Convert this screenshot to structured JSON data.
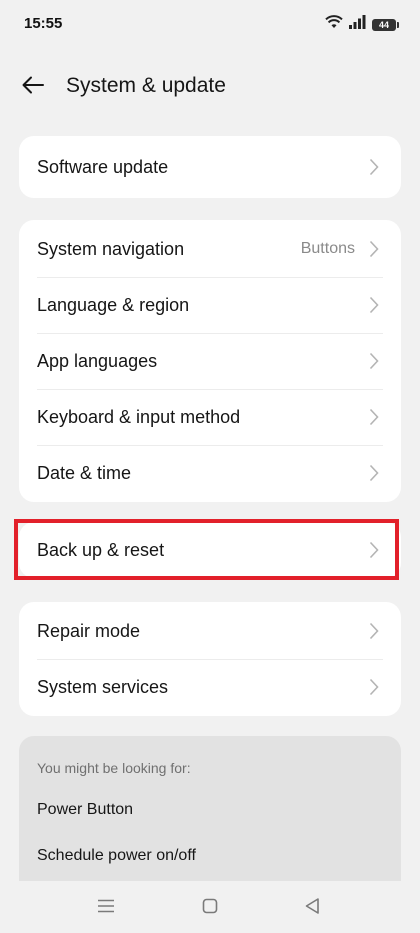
{
  "status_bar": {
    "time": "15:55",
    "battery": "44",
    "icons": [
      "wifi-icon",
      "cellular-signal-icon",
      "battery-icon"
    ]
  },
  "header": {
    "title": "System & update",
    "back_icon": "back-arrow-icon"
  },
  "groups": [
    {
      "items": [
        {
          "label": "Software update"
        }
      ]
    },
    {
      "items": [
        {
          "label": "System navigation",
          "value": "Buttons"
        },
        {
          "label": "Language & region"
        },
        {
          "label": "App languages"
        },
        {
          "label": "Keyboard & input method"
        },
        {
          "label": "Date & time"
        }
      ]
    },
    {
      "items": [
        {
          "label": "Back up & reset"
        }
      ]
    },
    {
      "items": [
        {
          "label": "Repair mode"
        },
        {
          "label": "System services"
        }
      ]
    }
  ],
  "suggestions": {
    "heading": "You might be looking for:",
    "items": [
      "Power Button",
      "Schedule power on/off"
    ]
  },
  "highlight_color": "#e2202a",
  "nav_bar": {
    "icons": [
      "menu-icon",
      "home-square-icon",
      "back-triangle-icon"
    ]
  }
}
